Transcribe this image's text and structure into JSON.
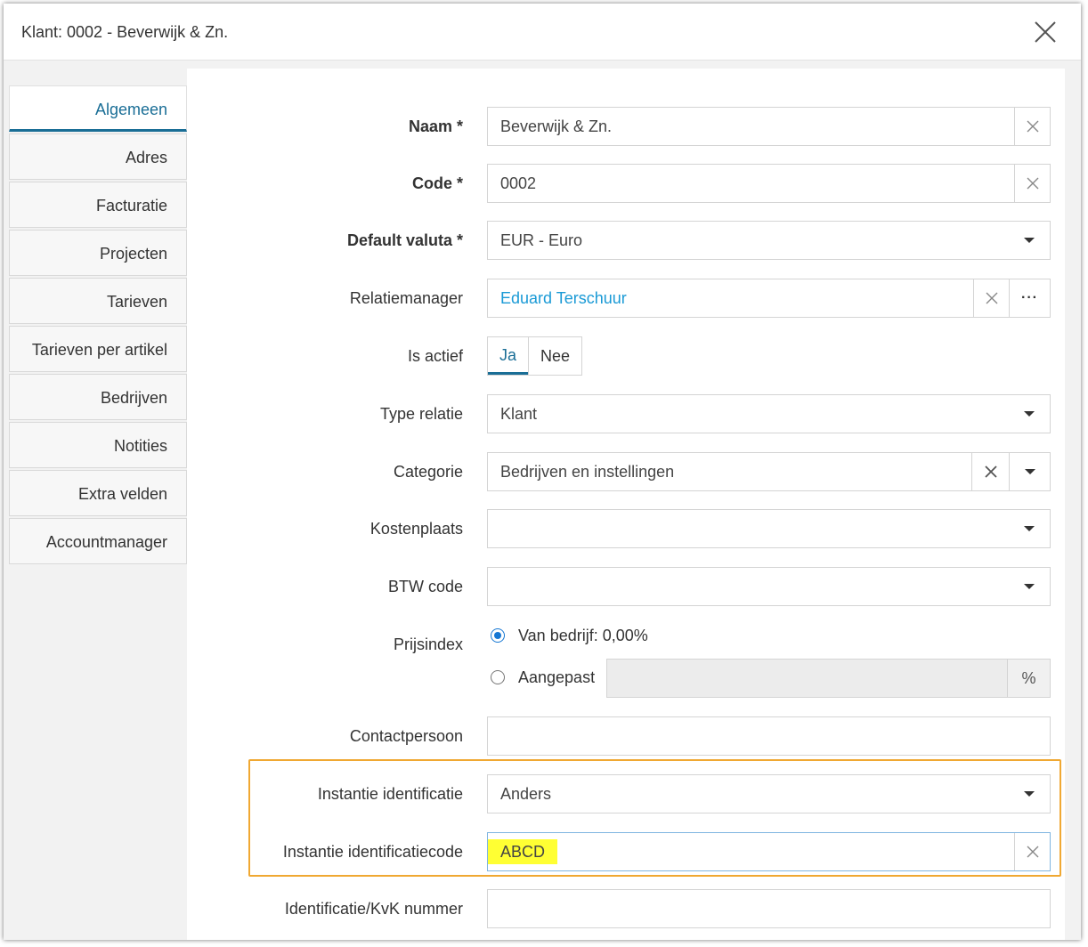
{
  "dialog": {
    "title": "Klant: 0002 - Beverwijk & Zn."
  },
  "tabs": [
    {
      "label": "Algemeen",
      "active": true
    },
    {
      "label": "Adres"
    },
    {
      "label": "Facturatie"
    },
    {
      "label": "Projecten"
    },
    {
      "label": "Tarieven"
    },
    {
      "label": "Tarieven per artikel"
    },
    {
      "label": "Bedrijven"
    },
    {
      "label": "Notities"
    },
    {
      "label": "Extra velden"
    },
    {
      "label": "Accountmanager"
    }
  ],
  "form": {
    "naam": {
      "label": "Naam *",
      "value": "Beverwijk & Zn."
    },
    "code": {
      "label": "Code *",
      "value": "0002"
    },
    "valuta": {
      "label": "Default valuta *",
      "value": "EUR - Euro"
    },
    "relatiemanager": {
      "label": "Relatiemanager",
      "value": "Eduard Terschuur",
      "more": "···"
    },
    "actief": {
      "label": "Is actief",
      "yes": "Ja",
      "no": "Nee",
      "selected": "Ja"
    },
    "type_relatie": {
      "label": "Type relatie",
      "value": "Klant"
    },
    "categorie": {
      "label": "Categorie",
      "value": "Bedrijven en instellingen"
    },
    "kostenplaats": {
      "label": "Kostenplaats",
      "value": ""
    },
    "btw": {
      "label": "BTW code",
      "value": ""
    },
    "prijsindex": {
      "label": "Prijsindex",
      "option1": "Van bedrijf: 0,00%",
      "option2": "Aangepast",
      "unit": "%",
      "selected": "option1"
    },
    "contactpersoon": {
      "label": "Contactpersoon",
      "value": ""
    },
    "instantie_id": {
      "label": "Instantie identificatie",
      "value": "Anders"
    },
    "instantie_code": {
      "label": "Instantie identificatiecode",
      "value": "ABCD"
    },
    "kvk": {
      "label": "Identificatie/KvK nummer",
      "value": ""
    }
  },
  "colors": {
    "accent": "#1a6e96",
    "link": "#1a9ad6",
    "highlight_border": "#f0a832",
    "text_highlight": "#ffff33"
  },
  "icons": {
    "close": "close-icon",
    "clear": "clear-icon",
    "dropdown": "chevron-down-icon",
    "more": "ellipsis-icon"
  }
}
